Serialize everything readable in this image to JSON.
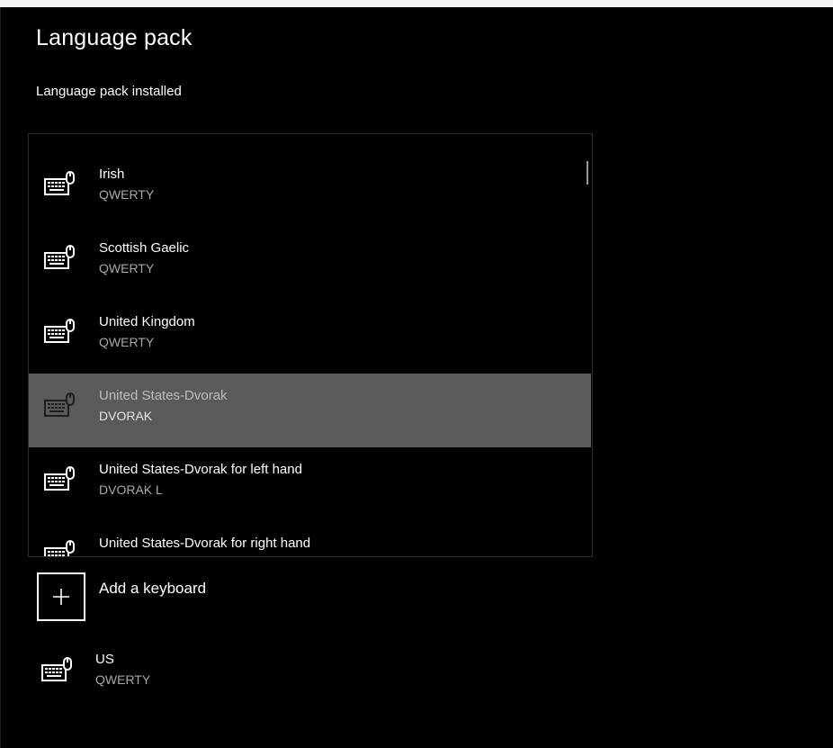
{
  "section": {
    "title": "Language pack",
    "status": "Language pack installed"
  },
  "keyboard_picker": {
    "items": [
      {
        "name": "Irish",
        "layout": "QWERTY",
        "selected": false
      },
      {
        "name": "Scottish Gaelic",
        "layout": "QWERTY",
        "selected": false
      },
      {
        "name": "United Kingdom",
        "layout": "QWERTY",
        "selected": false
      },
      {
        "name": "United States-Dvorak",
        "layout": "DVORAK",
        "selected": true
      },
      {
        "name": "United States-Dvorak for left hand",
        "layout": "DVORAK L",
        "selected": false
      },
      {
        "name": "United States-Dvorak for right hand",
        "layout": "",
        "selected": false
      }
    ]
  },
  "add_keyboard": {
    "label": "Add a keyboard",
    "icon": "plus-icon"
  },
  "installed_keyboards": [
    {
      "name": "US",
      "layout": "QWERTY",
      "icon": "keyboard-icon"
    }
  ],
  "colors": {
    "background": "#000000",
    "selected_row": "#5a5a5a",
    "secondary_text": "#a8a8a8"
  }
}
